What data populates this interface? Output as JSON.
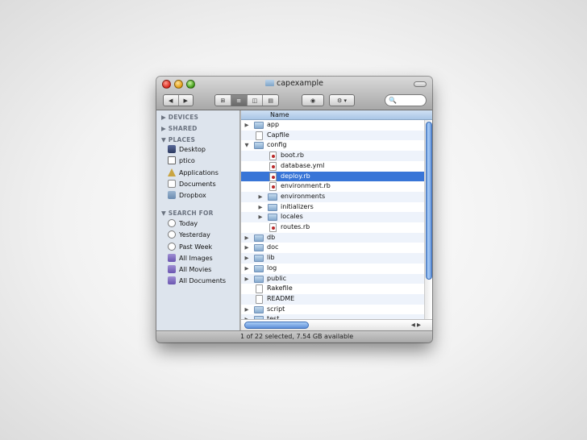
{
  "window": {
    "title": "capexample",
    "status": "1 of 22 selected, 7.54 GB available"
  },
  "toolbar": {
    "back_icon": "◀",
    "forward_icon": "▶",
    "view_icons": [
      "⊞",
      "≡",
      "◫",
      "▤"
    ],
    "quicklook_icon": "◉",
    "action_icon": "⚙ ▾",
    "search_icon": "🔍"
  },
  "sidebar": {
    "devices": "▶ DEVICES",
    "shared": "▶ SHARED",
    "places": "▼ PLACES",
    "places_items": [
      "Desktop",
      "ptico",
      "Applications",
      "Documents",
      "Dropbox"
    ],
    "search_for": "▼ SEARCH FOR",
    "search_items": [
      "Today",
      "Yesterday",
      "Past Week",
      "All Images",
      "All Movies",
      "All Documents"
    ]
  },
  "list": {
    "header": "Name",
    "rows": [
      "app",
      "Capfile",
      "config",
      "boot.rb",
      "database.yml",
      "deploy.rb",
      "environment.rb",
      "environments",
      "initializers",
      "locales",
      "routes.rb",
      "db",
      "doc",
      "lib",
      "log",
      "public",
      "Rakefile",
      "README",
      "script",
      "test"
    ],
    "tri_collapsed": "▶",
    "tri_expanded": "▼",
    "hscroll_arrows": "◀ ▶"
  },
  "colors": {
    "selection": "#3875d7",
    "sidebar_bg": "#dde4ed",
    "alt_row": "#eef3fb"
  }
}
